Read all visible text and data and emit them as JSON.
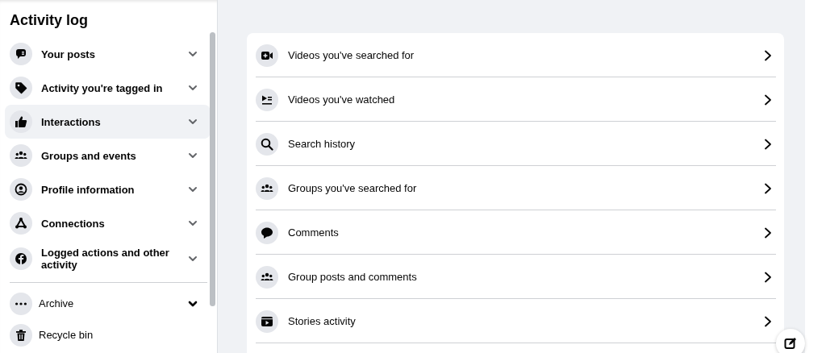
{
  "sidebar": {
    "title": "Activity log",
    "items": [
      {
        "label": "Your posts",
        "selected": false,
        "expanded": false
      },
      {
        "label": "Activity you're tagged in",
        "selected": false,
        "expanded": false
      },
      {
        "label": "Interactions",
        "selected": true,
        "expanded": false
      },
      {
        "label": "Groups and events",
        "selected": false,
        "expanded": false
      },
      {
        "label": "Profile information",
        "selected": false,
        "expanded": false
      },
      {
        "label": "Connections",
        "selected": false,
        "expanded": false
      },
      {
        "label": "Logged actions and other activity",
        "selected": false,
        "expanded": false
      }
    ],
    "extras": [
      {
        "label": "Archive",
        "kind": "expandable"
      },
      {
        "label": "Recycle bin",
        "kind": "link"
      }
    ]
  },
  "main": {
    "rows": [
      {
        "label": "Videos you've searched for"
      },
      {
        "label": "Videos you've watched"
      },
      {
        "label": "Search history"
      },
      {
        "label": "Groups you've searched for"
      },
      {
        "label": "Comments"
      },
      {
        "label": "Group posts and comments"
      },
      {
        "label": "Stories activity"
      }
    ]
  }
}
